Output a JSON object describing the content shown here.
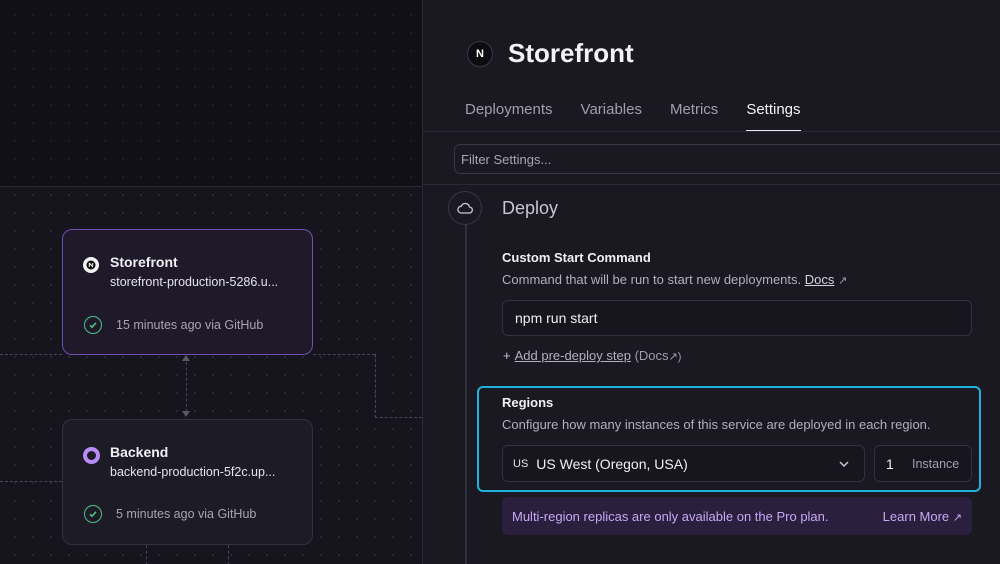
{
  "canvas": {
    "services": [
      {
        "name": "Storefront",
        "url": "storefront-production-5286.u...",
        "status": "15 minutes ago via GitHub",
        "icon": "nextjs-icon",
        "selected": true
      },
      {
        "name": "Backend",
        "url": "backend-production-5f2c.up...",
        "status": "5 minutes ago via GitHub",
        "icon": "backend-ring-icon",
        "selected": false
      }
    ]
  },
  "panel": {
    "title": "Storefront",
    "logo_letter": "N",
    "tabs": [
      {
        "label": "Deployments",
        "active": false
      },
      {
        "label": "Variables",
        "active": false
      },
      {
        "label": "Metrics",
        "active": false
      },
      {
        "label": "Settings",
        "active": true
      }
    ],
    "filter_placeholder": "Filter Settings...",
    "section": {
      "title": "Deploy",
      "icon": "cloud-icon"
    },
    "start_command": {
      "label": "Custom Start Command",
      "help": "Command that will be run to start new deployments.",
      "docs_link": "Docs",
      "value": "npm run start",
      "predeploy_link": "Add pre-deploy step",
      "predeploy_docs": "(Docs"
    },
    "regions": {
      "label": "Regions",
      "help": "Configure how many instances of this service are deployed in each region.",
      "region_code": "US",
      "region_name": "US West (Oregon, USA)",
      "instance_count": "1",
      "instance_unit": "Instance"
    },
    "notice": {
      "text": "Multi-region replicas are only available on the Pro plan.",
      "link": "Learn More"
    }
  },
  "colors": {
    "accent_purple": "#6d4fb1",
    "highlight_cyan": "#1fb3d9",
    "success_green": "#4fbf88",
    "notice_bg": "#2a1f3d"
  }
}
